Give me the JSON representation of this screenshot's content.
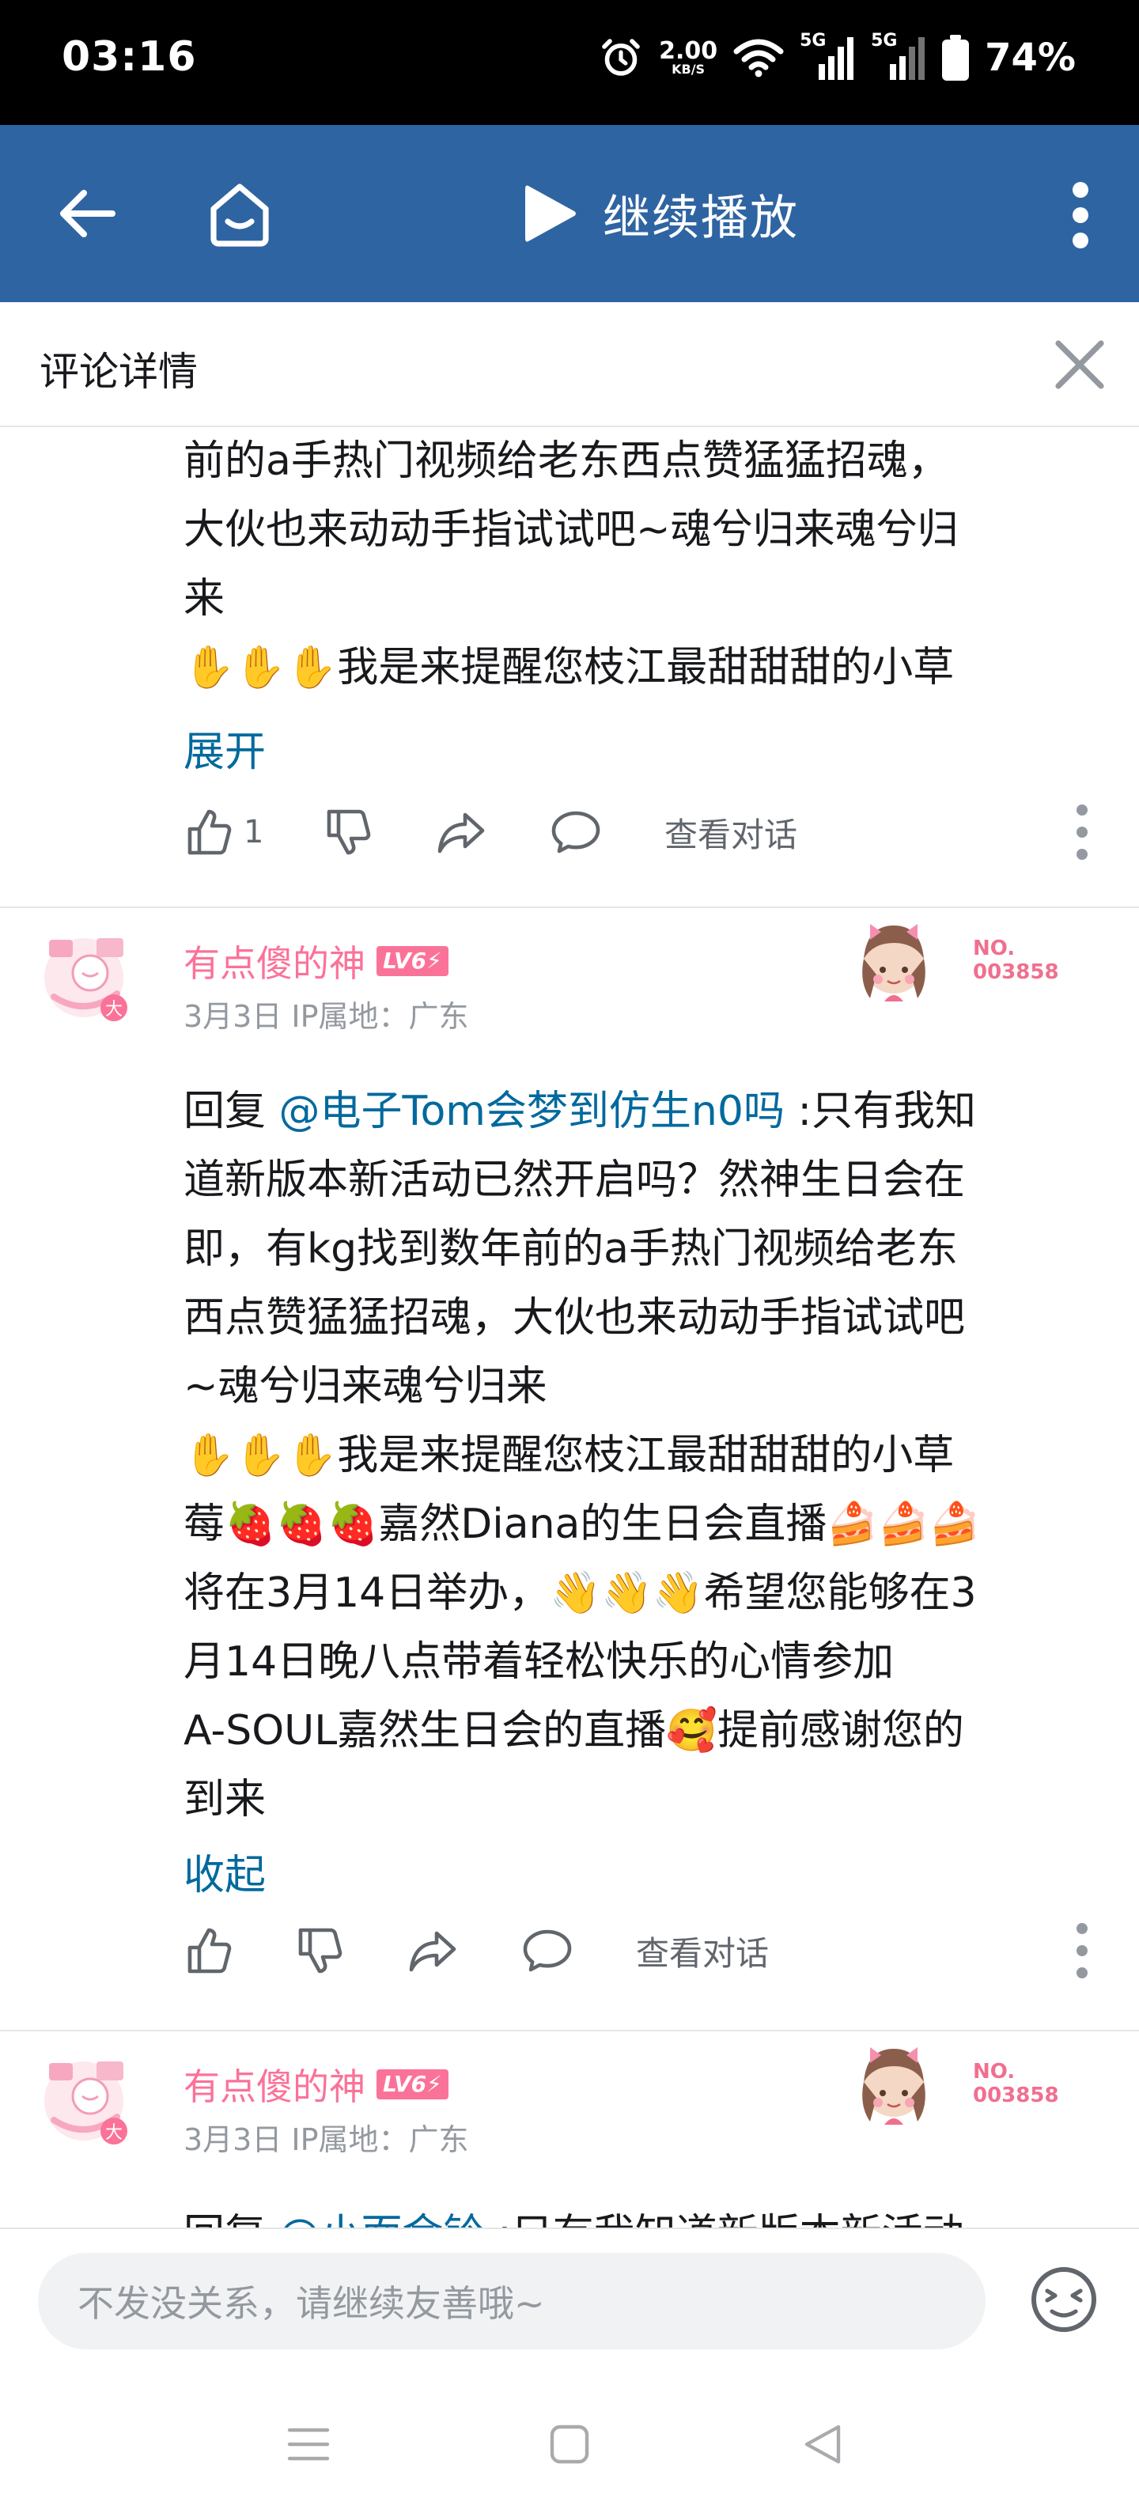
{
  "status_bar": {
    "time": "03:16",
    "net_speed_value": "2.00",
    "net_speed_unit": "KB/S",
    "signal1_label": "5G",
    "signal2_label": "5G",
    "battery": "74%"
  },
  "player_bar": {
    "continue_label": "继续播放",
    "bg_color": "#2f64a2"
  },
  "detail": {
    "title": "评论详情"
  },
  "comments": [
    {
      "lines": [
        "前的a手热门视频给老东西点赞猛猛招魂，",
        "大伙也来动动手指试试吧~魂兮归来魂兮归",
        "来",
        "✋✋✋我是来提醒您枝江最甜甜甜的小草"
      ],
      "toggle_label": "展开",
      "like_count": "1",
      "dialog_label": "查看对话"
    },
    {
      "user_name": "有点傻的神",
      "level": "LV6⚡",
      "meta": "3月3日 IP属地：广东",
      "fan_no_label": "NO.",
      "fan_no_value": "003858",
      "reply_prefix": "回复 ",
      "mention": "@电子Tom会梦到仿生n0吗",
      "first_line_rest": " :只有我知",
      "lines": [
        "道新版本新活动已然开启吗？然神生日会在",
        "即，有kg找到数年前的a手热门视频给老东",
        "西点赞猛猛招魂，大伙也来动动手指试试吧",
        "~魂兮归来魂兮归来",
        "✋✋✋我是来提醒您枝江最甜甜甜的小草",
        "莓🍓🍓🍓嘉然Diana的生日会直播🍰🍰🍰",
        "将在3月14日举办，👋👋👋希望您能够在3",
        "月14日晚八点带着轻松快乐的心情参加",
        "A-SOUL嘉然生日会的直播🥰提前感谢您的",
        "到来"
      ],
      "toggle_label": "收起",
      "dialog_label": "查看对话"
    },
    {
      "user_name": "有点傻的神",
      "level": "LV6⚡",
      "meta": "3月3日 IP属地：广东",
      "fan_no_label": "NO.",
      "fan_no_value": "003858",
      "reply_prefix": "回复 ",
      "mention": "@小面金铃",
      "first_line_rest": " :只有我知道新版本新活动"
    }
  ],
  "input": {
    "placeholder": "不发没关系，请继续友善哦~"
  },
  "colors": {
    "accent_pink": "#fb7299",
    "link_blue": "#00699d",
    "muted_gray": "#9499a0"
  },
  "icons": [
    "back-arrow-icon",
    "home-tv-icon",
    "play-icon",
    "more-vertical-icon",
    "close-icon",
    "thumb-up-icon",
    "thumb-down-icon",
    "share-icon",
    "comment-icon",
    "emoji-icon",
    "menu-icon",
    "square-icon",
    "back-triangle-icon"
  ]
}
